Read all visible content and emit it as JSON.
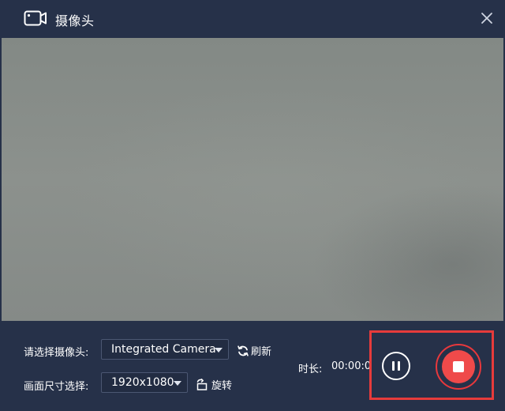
{
  "window": {
    "title": "摄像头"
  },
  "settings": {
    "camera_label": "请选择摄像头:",
    "camera_value": "Integrated Camera",
    "refresh_label": "刷新",
    "size_label": "画面尺寸选择:",
    "size_value": "1920x1080",
    "rotate_label": "旋转"
  },
  "recording": {
    "duration_label": "时长:",
    "duration_value": "00:00:0"
  },
  "icons": {
    "title": "video-camera-icon",
    "close": "close-icon",
    "refresh": "refresh-icon",
    "rotate": "rotate-icon",
    "pause": "pause-icon",
    "stop": "stop-icon"
  },
  "colors": {
    "background": "#263149",
    "accent_red": "#ef4a4a",
    "highlight_box": "#e63b3b"
  }
}
